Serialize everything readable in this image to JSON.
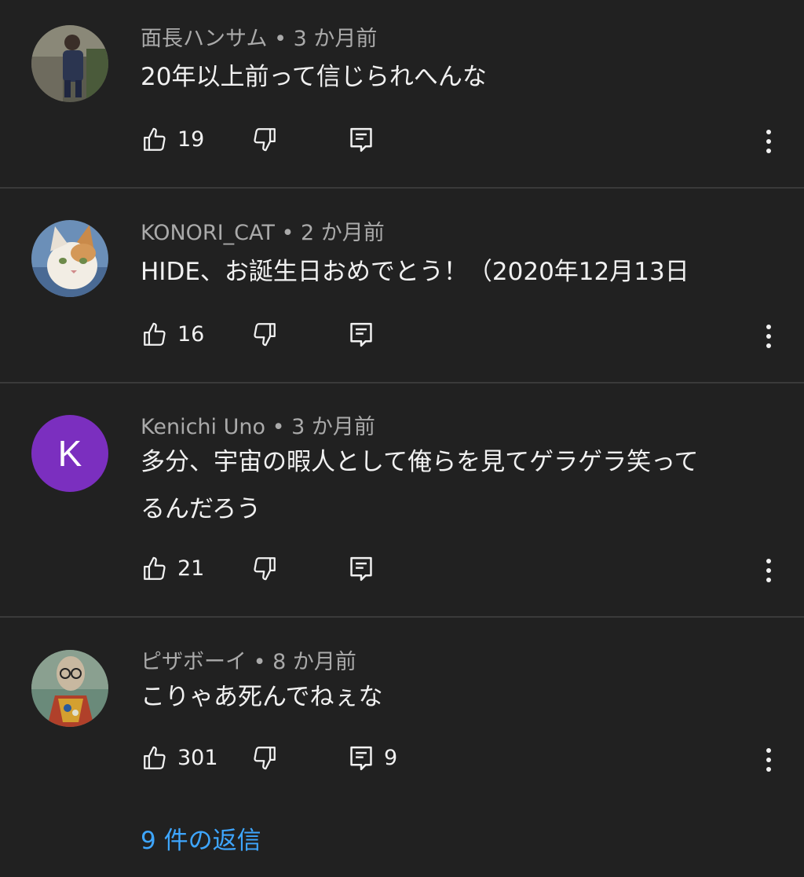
{
  "comments": [
    {
      "author": "面長ハンサム",
      "time": "3 か月前",
      "text_lines": [
        "20年以上前って信じられへんな"
      ],
      "likes": "19",
      "replies": "",
      "avatar_kind": "photo-person"
    },
    {
      "author": "KONORI_CAT",
      "time": "2 か月前",
      "text_lines": [
        "HIDE、お誕生日おめでとう！（2020年12月13日"
      ],
      "likes": "16",
      "replies": "",
      "avatar_kind": "photo-cat"
    },
    {
      "author": "Kenichi Uno",
      "time": "3 か月前",
      "text_lines": [
        "多分、宇宙の暇人として俺らを見てゲラゲラ笑って",
        "るんだろう"
      ],
      "likes": "21",
      "replies": "",
      "avatar_kind": "letter",
      "avatar_letter": "K"
    },
    {
      "author": "ピザボーイ",
      "time": "8 か月前",
      "text_lines": [
        "こりゃあ死んでねぇな"
      ],
      "likes": "301",
      "replies": "9",
      "avatar_kind": "photo-art"
    }
  ],
  "separator": "•",
  "replies_link": "9 件の返信",
  "icons": {
    "like": "thumb-up-icon",
    "dislike": "thumb-down-icon",
    "reply": "reply-comment-icon",
    "more": "more-vertical-icon"
  },
  "colors": {
    "background": "#212121",
    "text": "#f1f1f1",
    "meta": "#aaaaaa",
    "link": "#3ea6ff",
    "avatar_letter_bg": "#7b2fbf"
  }
}
